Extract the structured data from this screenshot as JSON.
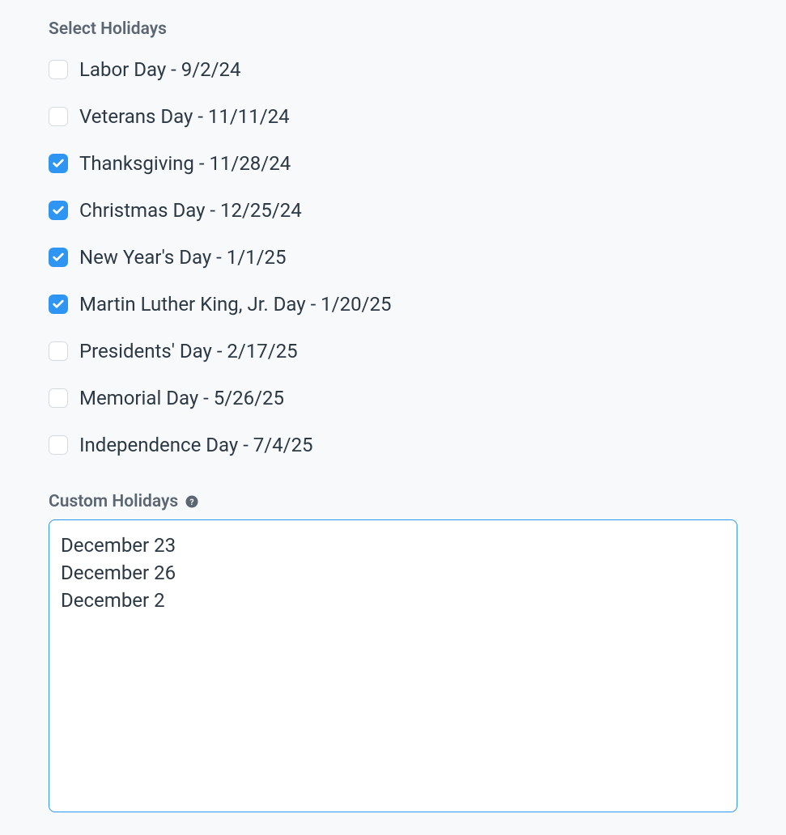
{
  "section_title": "Select Holidays",
  "holidays": [
    {
      "label": "Labor Day - 9/2/24",
      "checked": false
    },
    {
      "label": "Veterans Day - 11/11/24",
      "checked": false
    },
    {
      "label": "Thanksgiving - 11/28/24",
      "checked": true
    },
    {
      "label": "Christmas Day - 12/25/24",
      "checked": true
    },
    {
      "label": "New Year's Day - 1/1/25",
      "checked": true
    },
    {
      "label": "Martin Luther King, Jr. Day - 1/20/25",
      "checked": true
    },
    {
      "label": "Presidents' Day - 2/17/25",
      "checked": false
    },
    {
      "label": "Memorial Day - 5/26/25",
      "checked": false
    },
    {
      "label": "Independence Day - 7/4/25",
      "checked": false
    }
  ],
  "custom_title": "Custom Holidays",
  "custom_value": "December 23\nDecember 26\nDecember 2"
}
